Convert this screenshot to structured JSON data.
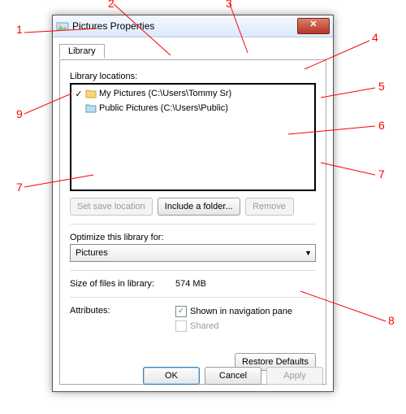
{
  "window": {
    "title": "Pictures Properties"
  },
  "tab": {
    "label": "Library"
  },
  "locations": {
    "label": "Library locations:",
    "items": [
      {
        "checked": true,
        "name": "My Pictures (C:\\Users\\Tommy Sr)"
      },
      {
        "checked": false,
        "name": "Public Pictures (C:\\Users\\Public)"
      }
    ]
  },
  "buttons": {
    "set_save": "Set save location",
    "include": "Include a folder...",
    "remove": "Remove",
    "restore": "Restore Defaults",
    "ok": "OK",
    "cancel": "Cancel",
    "apply": "Apply"
  },
  "optimize": {
    "label": "Optimize this library for:",
    "value": "Pictures"
  },
  "size": {
    "label": "Size of files in library:",
    "value": "574 MB"
  },
  "attributes": {
    "label": "Attributes:",
    "shown": {
      "label": "Shown in navigation pane",
      "checked": true
    },
    "shared": {
      "label": "Shared",
      "checked": false
    }
  },
  "annotations": {
    "n1": "1",
    "n2": "2",
    "n3": "3",
    "n4": "4",
    "n5": "5",
    "n6": "6",
    "n7": "7",
    "n8": "8",
    "n9": "9"
  }
}
